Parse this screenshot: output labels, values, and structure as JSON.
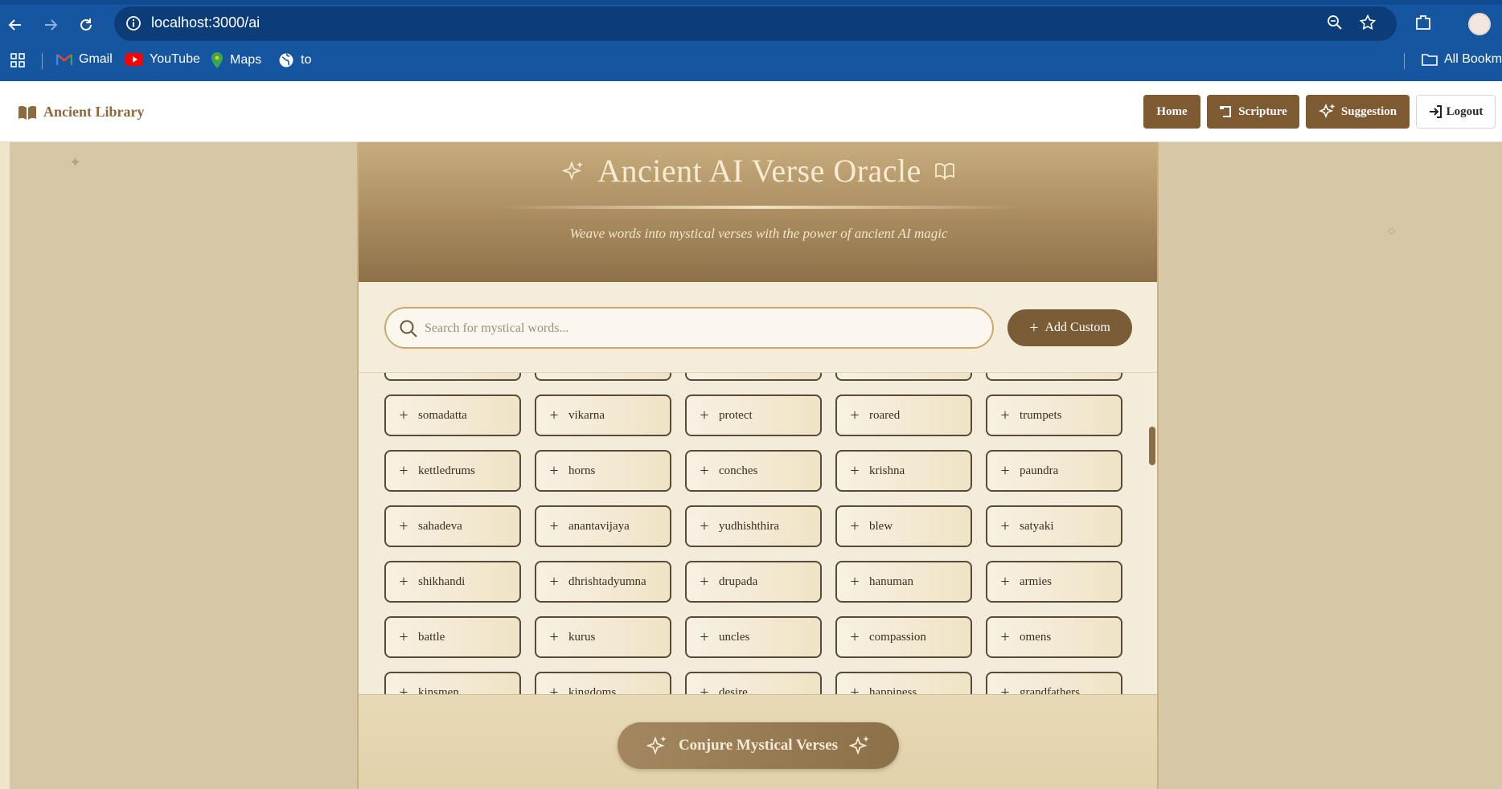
{
  "browser": {
    "url": "localhost:3000/ai",
    "bookmarks": [
      {
        "label": "Gmail",
        "icon": "gmail-icon"
      },
      {
        "label": "YouTube",
        "icon": "youtube-icon"
      },
      {
        "label": "Maps",
        "icon": "maps-icon"
      },
      {
        "label": "to",
        "icon": "globe-icon"
      }
    ],
    "all_bookmarks_label": "All Bookmarks"
  },
  "header": {
    "brand": "Ancient Library",
    "nav": {
      "home": "Home",
      "scripture": "Scripture",
      "suggestion": "Suggestion",
      "logout": "Logout"
    }
  },
  "oracle": {
    "title": "Ancient AI Verse Oracle",
    "subtitle": "Weave words into mystical verses with the power of ancient AI magic",
    "search_placeholder": "Search for mystical words...",
    "search_value": "",
    "add_custom_label": "Add Custom",
    "conjure_label": "Conjure Mystical Verses"
  },
  "words": [
    [
      "",
      "",
      "",
      "",
      ""
    ],
    [
      "somadatta",
      "vikarna",
      "protect",
      "roared",
      "trumpets"
    ],
    [
      "kettledrums",
      "horns",
      "conches",
      "krishna",
      "paundra"
    ],
    [
      "sahadeva",
      "anantavijaya",
      "yudhishthira",
      "blew",
      "satyaki"
    ],
    [
      "shikhandi",
      "dhrishtadyumna",
      "drupada",
      "hanuman",
      "armies"
    ],
    [
      "battle",
      "kurus",
      "uncles",
      "compassion",
      "omens"
    ],
    [
      "kinsmen",
      "kingdoms",
      "desire",
      "happiness",
      "grandfathers"
    ]
  ],
  "colors": {
    "chrome": "#1656a1",
    "accent": "#7d5a32",
    "panel_header": "#a98b5f"
  }
}
